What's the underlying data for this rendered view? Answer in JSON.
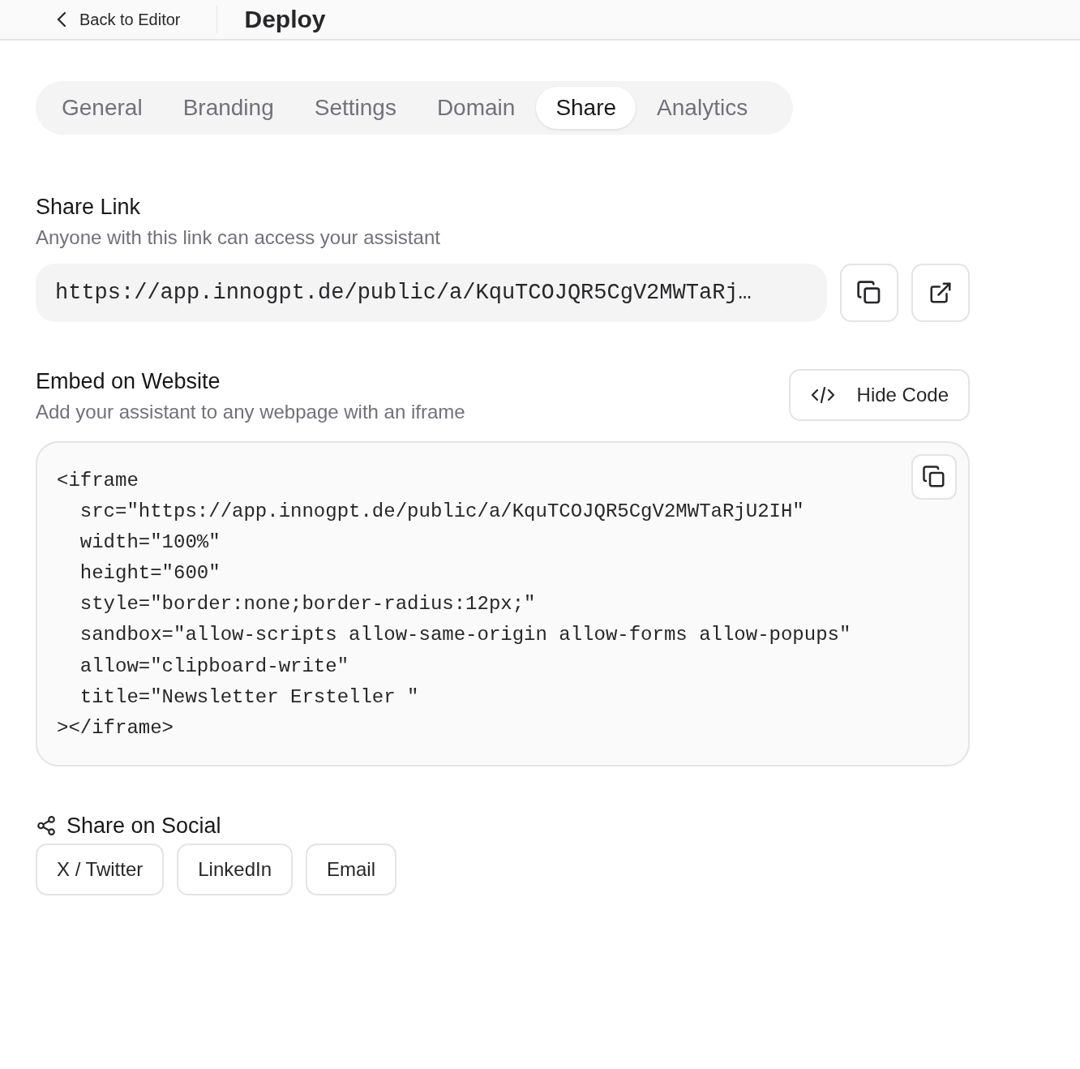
{
  "header": {
    "back_label": "Back to Editor",
    "title": "Deploy"
  },
  "tabs": [
    {
      "label": "General",
      "selected": false
    },
    {
      "label": "Branding",
      "selected": false
    },
    {
      "label": "Settings",
      "selected": false
    },
    {
      "label": "Domain",
      "selected": false
    },
    {
      "label": "Share",
      "selected": true
    },
    {
      "label": "Analytics",
      "selected": false
    }
  ],
  "share_link": {
    "title": "Share Link",
    "description": "Anyone with this link can access your assistant",
    "url": "https://app.innogpt.de/public/a/KquTCOJQR5CgV2MWTaRj…"
  },
  "embed": {
    "title": "Embed on Website",
    "description": "Add your assistant to any webpage with an iframe",
    "toggle_label": "Hide Code",
    "code_lines": [
      "<iframe",
      "  src=\"https://app.innogpt.de/public/a/KquTCOJQR5CgV2MWTaRjU2IH\"",
      "  width=\"100%\"",
      "  height=\"600\"",
      "  style=\"border:none;border-radius:12px;\"",
      "  sandbox=\"allow-scripts allow-same-origin allow-forms allow-popups\"",
      "  allow=\"clipboard-write\"",
      "  title=\"Newsletter Ersteller \"",
      "></iframe>"
    ]
  },
  "social": {
    "title": "Share on Social",
    "buttons": [
      "X / Twitter",
      "LinkedIn",
      "Email"
    ]
  }
}
